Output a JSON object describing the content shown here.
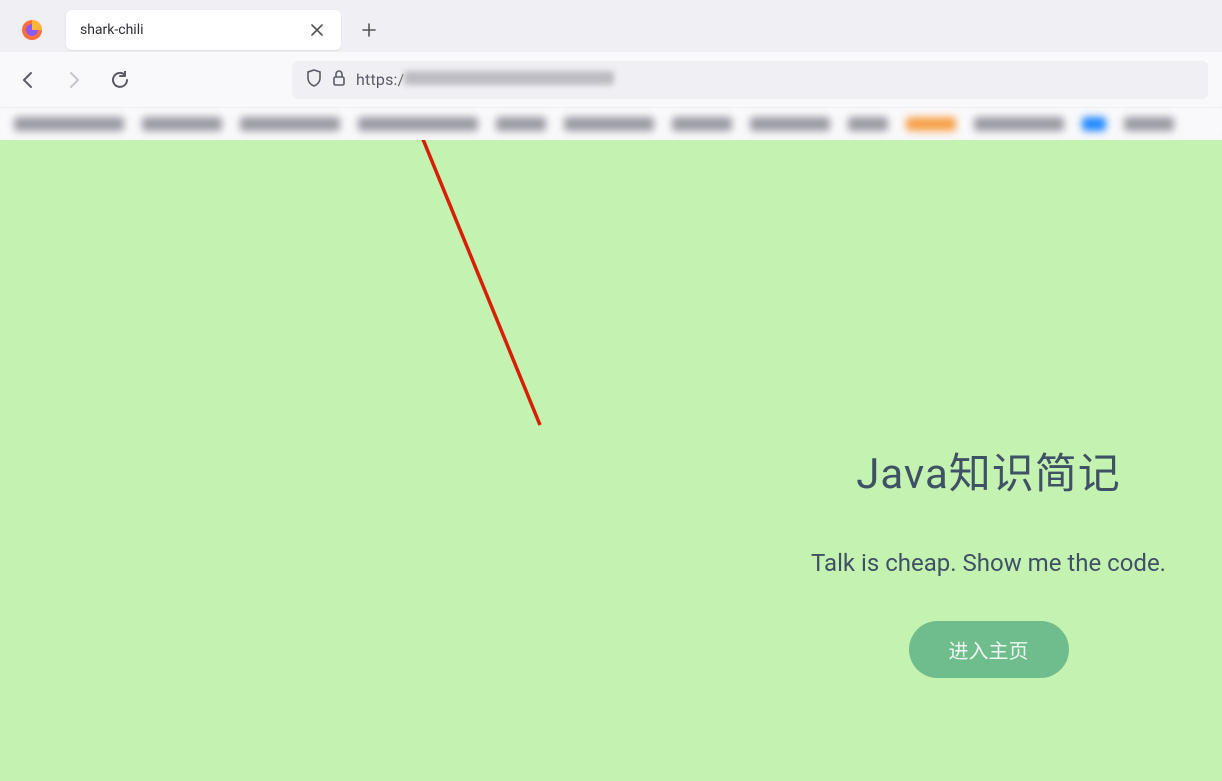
{
  "browser": {
    "tab_title": "shark-chili",
    "url_prefix": "https:/"
  },
  "page": {
    "title": "Java知识简记",
    "tagline": "Talk is cheap. Show me the code.",
    "enter_button": "进入主页"
  },
  "colors": {
    "content_bg": "#c4f2b0",
    "button_bg": "#6fbc8c",
    "arrow": "#d81e06"
  }
}
